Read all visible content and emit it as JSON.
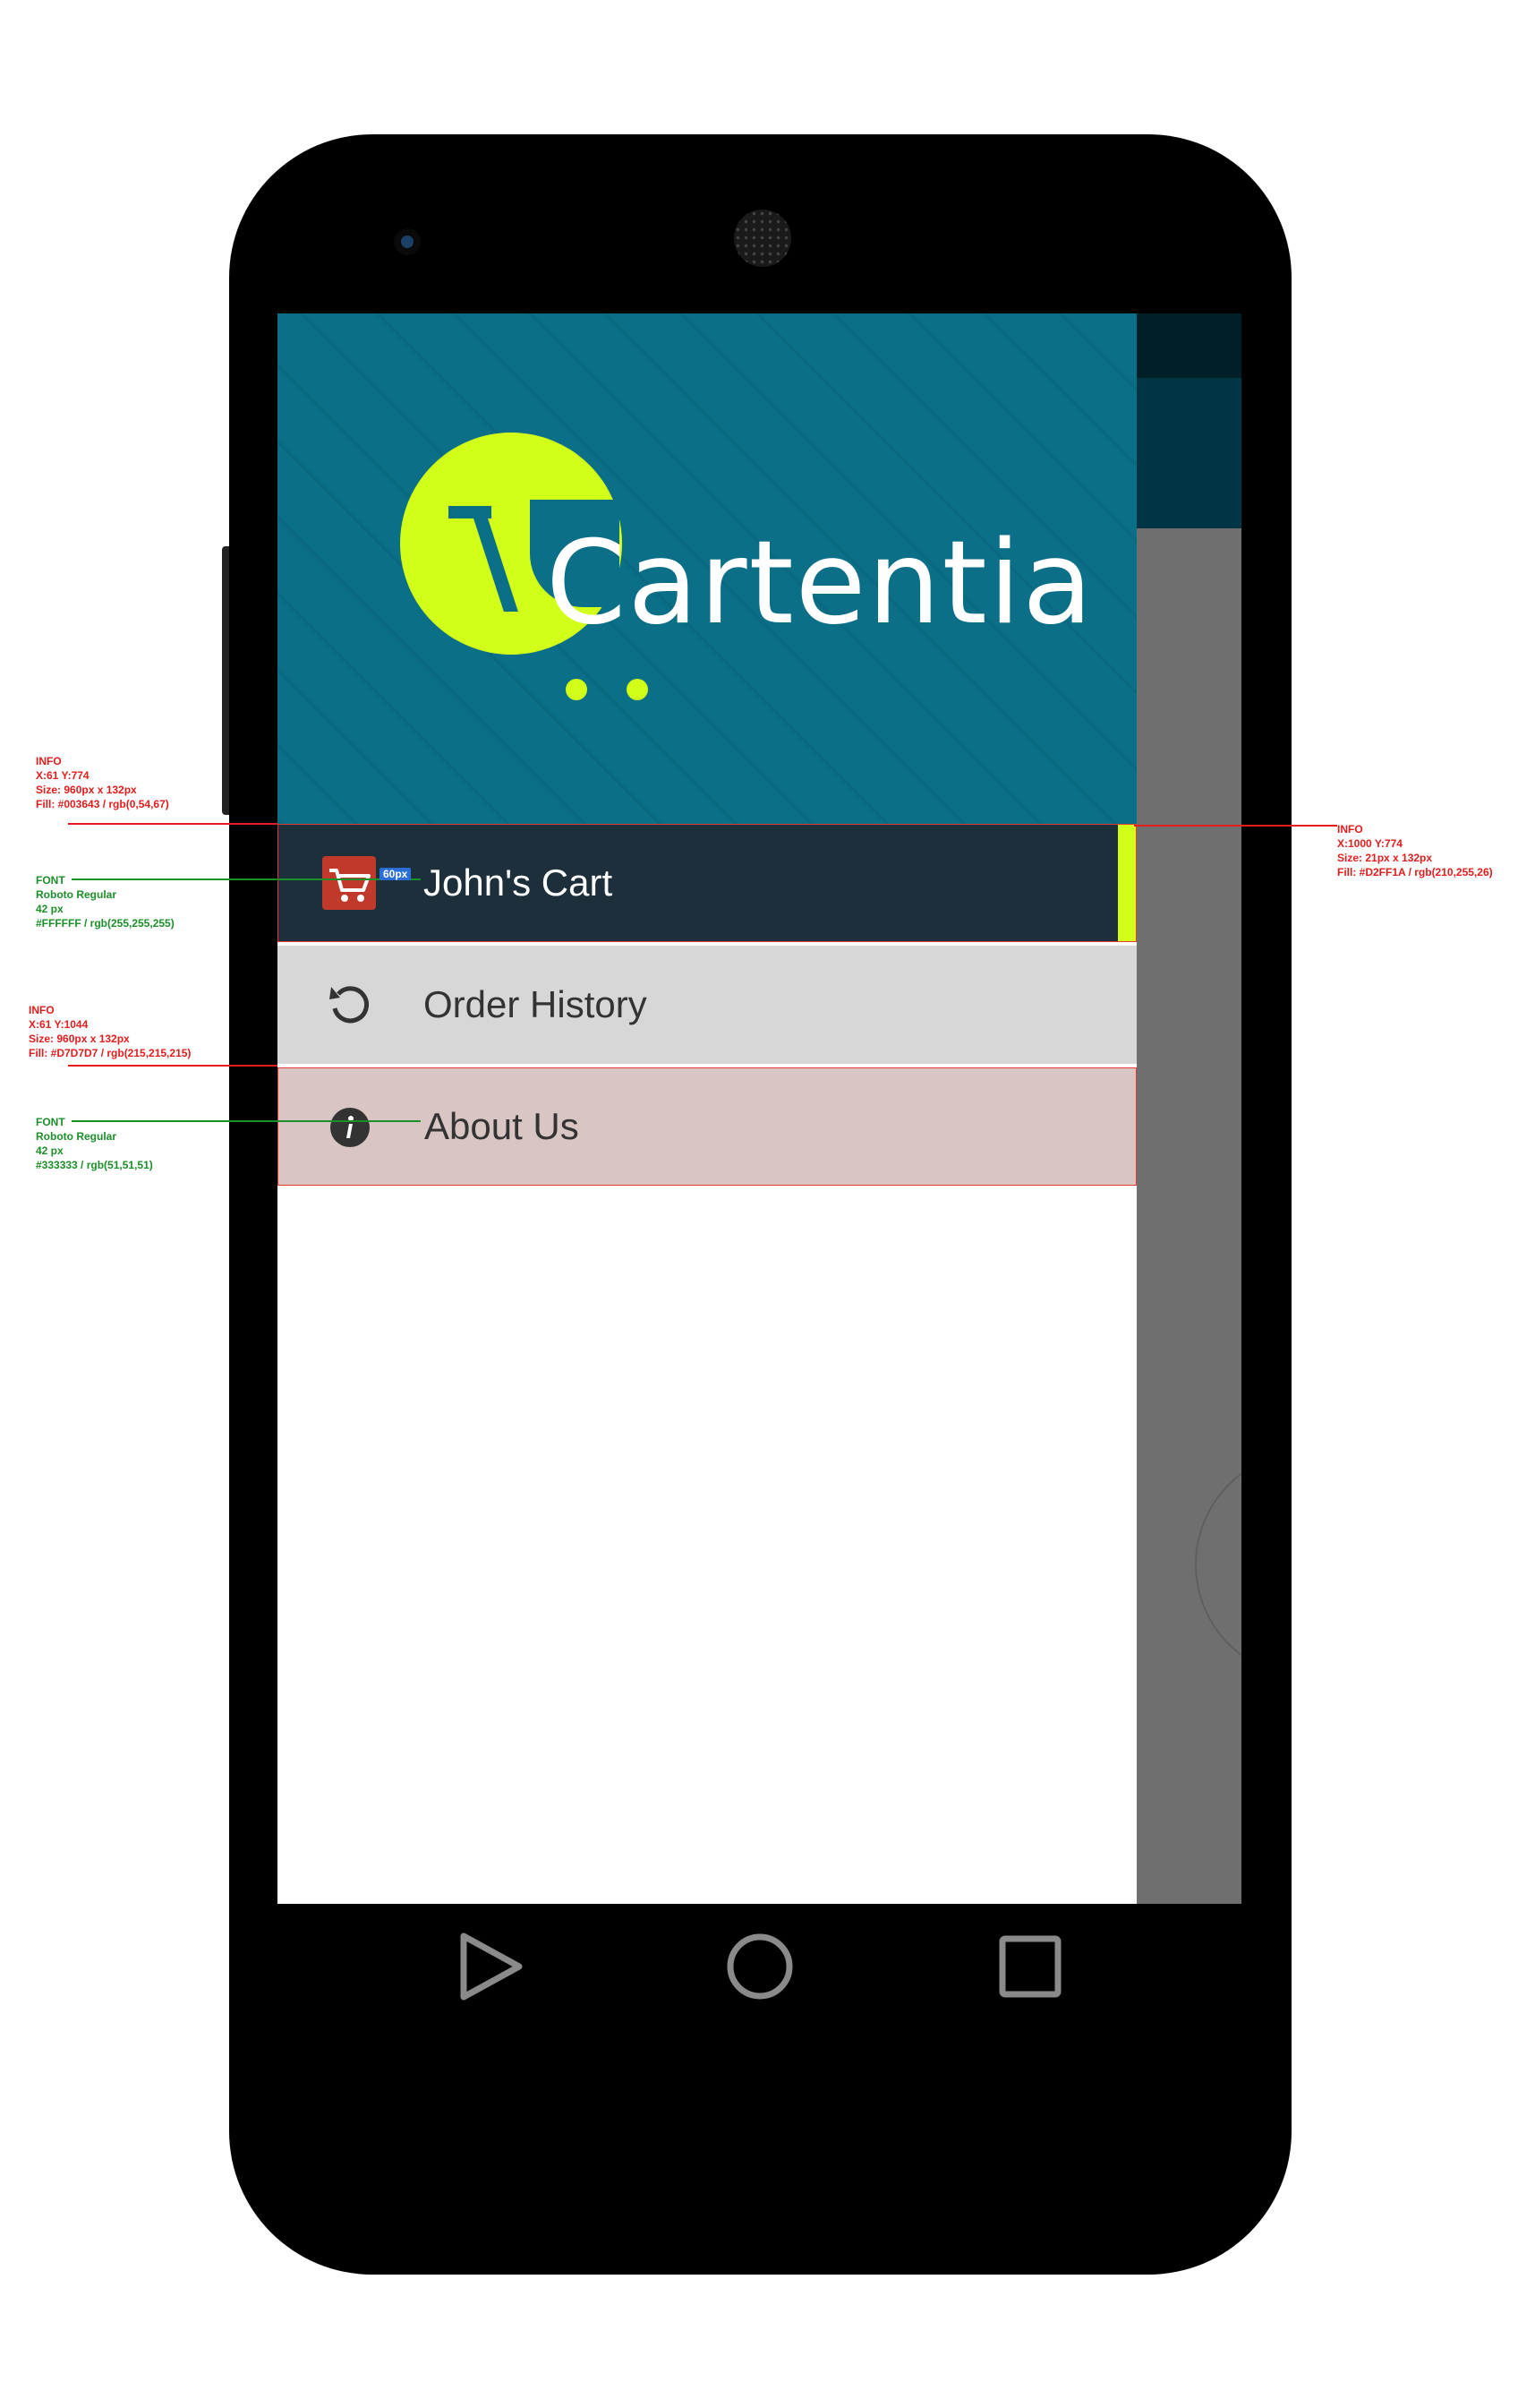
{
  "app": {
    "logo_text": "Cartentia"
  },
  "menu": {
    "items": [
      {
        "label": "John's Cart",
        "icon": "cart-icon",
        "active": true
      },
      {
        "label": "Order History",
        "icon": "history-icon"
      },
      {
        "label": "About Us",
        "icon": "info-icon"
      }
    ]
  },
  "annotations": {
    "info_cart_row": [
      "INFO",
      "X:61  Y:774",
      "Size: 960px x 132px",
      "Fill: #003643 / rgb(0,54,67)"
    ],
    "font_white": [
      "FONT",
      "Roboto Regular",
      "42 px",
      "#FFFFFF / rgb(255,255,255)"
    ],
    "info_history_row": [
      "INFO",
      "X:61  Y:1044",
      "Size: 960px x 132px",
      "Fill: #D7D7D7 / rgb(215,215,215)"
    ],
    "font_dark": [
      "FONT",
      "Roboto Regular",
      "42 px",
      "#333333 / rgb(51,51,51)"
    ],
    "info_indicator": [
      "INFO",
      "X:1000  Y:774",
      "Size: 21px x 132px",
      "Fill: #D2FF1A / rgb(210,255,26)"
    ],
    "icon_spacing": "60px"
  },
  "colors": {
    "toolbar": "#003643",
    "indicator": "#d2ff1a",
    "row_active": "#1e2f3c",
    "row_history": "#d7d7d7",
    "row_about": "#dac5c5"
  }
}
